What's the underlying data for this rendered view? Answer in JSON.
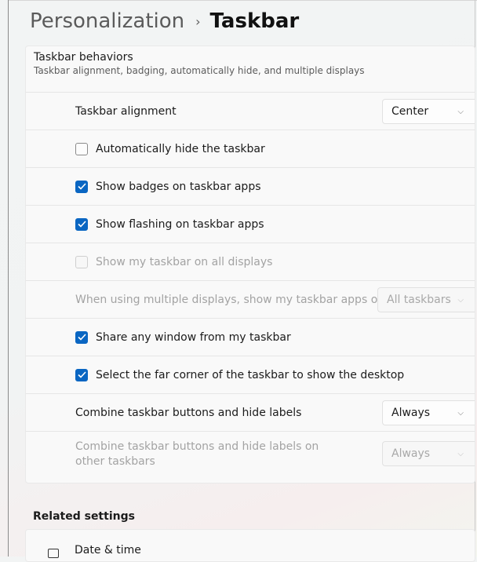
{
  "breadcrumb": {
    "parent": "Personalization",
    "separator": "›",
    "current": "Taskbar"
  },
  "behaviors": {
    "title": "Taskbar behaviors",
    "subtitle": "Taskbar alignment, badging, automatically hide, and multiple displays",
    "alignment": {
      "label": "Taskbar alignment",
      "value": "Center"
    },
    "auto_hide": {
      "label": "Automatically hide the taskbar",
      "checked": false
    },
    "badges": {
      "label": "Show badges on taskbar apps",
      "checked": true
    },
    "flashing": {
      "label": "Show flashing on taskbar apps",
      "checked": true
    },
    "all_displays": {
      "label": "Show my taskbar on all displays",
      "checked": false,
      "disabled": true
    },
    "multi_display": {
      "label": "When using multiple displays, show my taskbar apps on",
      "value": "All taskbars",
      "disabled": true
    },
    "share_window": {
      "label": "Share any window from my taskbar",
      "checked": true
    },
    "far_corner": {
      "label": "Select the far corner of the taskbar to show the desktop",
      "checked": true
    },
    "combine": {
      "label": "Combine taskbar buttons and hide labels",
      "value": "Always"
    },
    "combine_other": {
      "label": "Combine taskbar buttons and hide labels on other taskbars",
      "value": "Always",
      "disabled": true
    }
  },
  "related": {
    "title": "Related settings",
    "date_time": {
      "label": "Date & time",
      "icon": "calendar-icon"
    }
  },
  "colors": {
    "accent": "#0a66c2"
  }
}
